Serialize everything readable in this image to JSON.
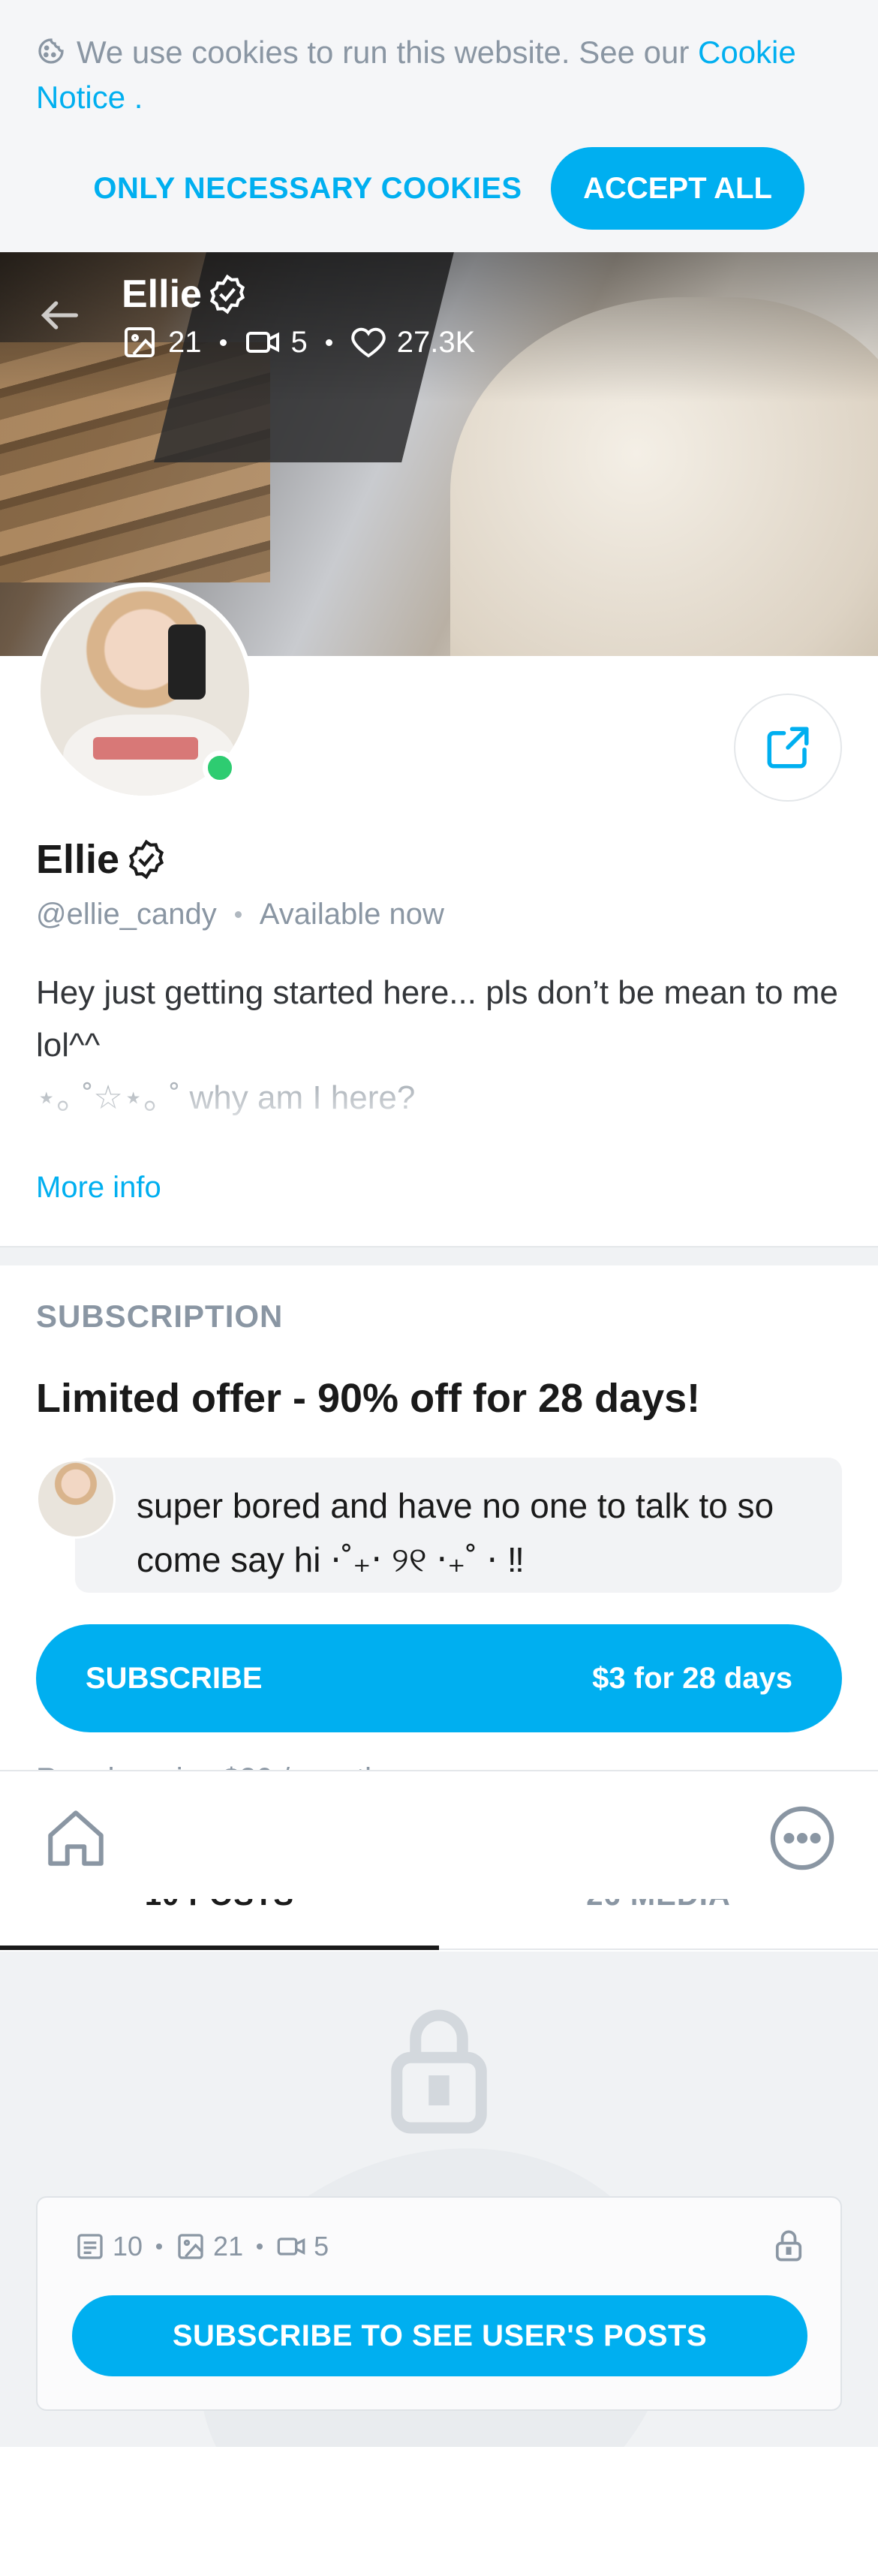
{
  "cookie_banner": {
    "text": "We use cookies to run this website. See our",
    "link_text": "Cookie Notice",
    "period": ".",
    "necessary_label": "ONLY NECESSARY COOKIES",
    "accept_label": "ACCEPT ALL"
  },
  "header": {
    "name": "Ellie",
    "photos_count": "21",
    "videos_count": "5",
    "likes_count": "27.3K"
  },
  "profile": {
    "name": "Ellie",
    "handle": "@ellie_candy",
    "status": "Available now",
    "bio_line1": "Hey just getting started here... pls don’t be mean to me lol^^",
    "bio_line2": "⋆｡ ˚☆⋆｡ ˚ why am I here?",
    "more_info": "More info"
  },
  "subscription": {
    "section_label": "SUBSCRIPTION",
    "offer_title": "Limited offer - 90% off for 28 days!",
    "message": "super bored and have no one to talk to so come say hi ⋅˚₊‧ ୨୧ ‧₊˚ ⋅ ‼",
    "button_label": "SUBSCRIBE",
    "button_price": "$3 for 28 days",
    "regular_price": "Regular price $30 / month"
  },
  "tabs": [
    {
      "label": "10 POSTS"
    },
    {
      "label": "26 MEDIA"
    }
  ],
  "locked": {
    "posts_count": "10",
    "photos_count": "21",
    "videos_count": "5",
    "button_label": "SUBSCRIBE TO SEE USER'S POSTS"
  },
  "colors": {
    "accent": "#00aff0",
    "muted": "#8a96a3",
    "online": "#2ecc71"
  }
}
